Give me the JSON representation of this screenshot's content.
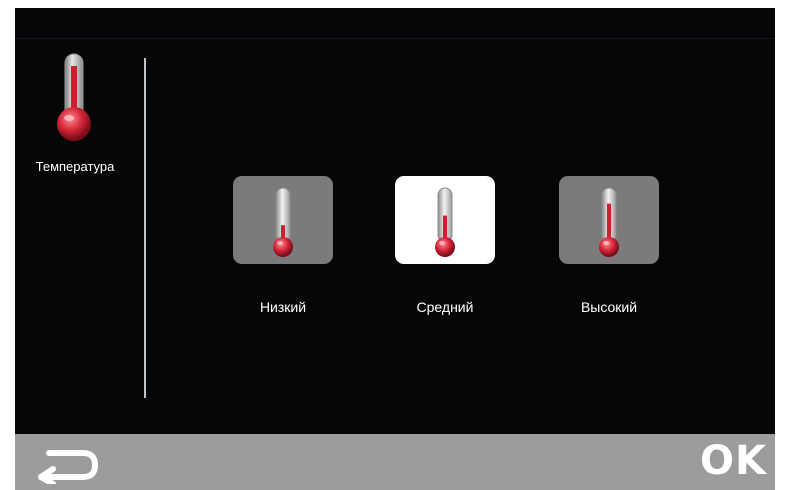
{
  "sidebar": {
    "label": "Температура",
    "icon": "thermometer-icon"
  },
  "options": [
    {
      "label": "Низкий",
      "selected": false,
      "level": 0.35,
      "icon": "thermometer-low-icon"
    },
    {
      "label": "Средний",
      "selected": true,
      "level": 0.55,
      "icon": "thermometer-medium-icon"
    },
    {
      "label": "Высокий",
      "selected": false,
      "level": 0.8,
      "icon": "thermometer-high-icon"
    }
  ],
  "footer": {
    "back_icon": "back-arrow-icon",
    "ok_label": "OK"
  },
  "colors": {
    "background": "#050607",
    "tile_inactive": "#7b7b7d",
    "tile_active": "#ffffff",
    "mercury": "#cc2030",
    "footer_bar": "#9a9c9e"
  }
}
